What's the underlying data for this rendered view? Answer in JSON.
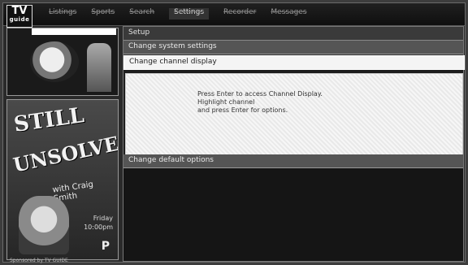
{
  "logo": {
    "line1": "TV",
    "line2": "guide"
  },
  "menu": [
    {
      "label": "Listings"
    },
    {
      "label": "Sports"
    },
    {
      "label": "Search"
    },
    {
      "label": "Settings",
      "active": true
    },
    {
      "label": "Recorder"
    },
    {
      "label": "Messages"
    }
  ],
  "promo": {
    "title_line1": "STILL",
    "title_line2": "UNSOLVED",
    "host": "with Craig Smith",
    "when": "Friday\n10:00pm",
    "network": "P",
    "caption": "Sponsored by TV GUIDE"
  },
  "panel": {
    "title": "Setup",
    "rows": [
      {
        "label": "Change system settings"
      },
      {
        "label": "Change channel display"
      },
      {
        "label": "Change default options"
      }
    ],
    "info_lines": [
      "Press Enter to access Channel Display.",
      "Highlight channel",
      "and press Enter for options."
    ]
  }
}
